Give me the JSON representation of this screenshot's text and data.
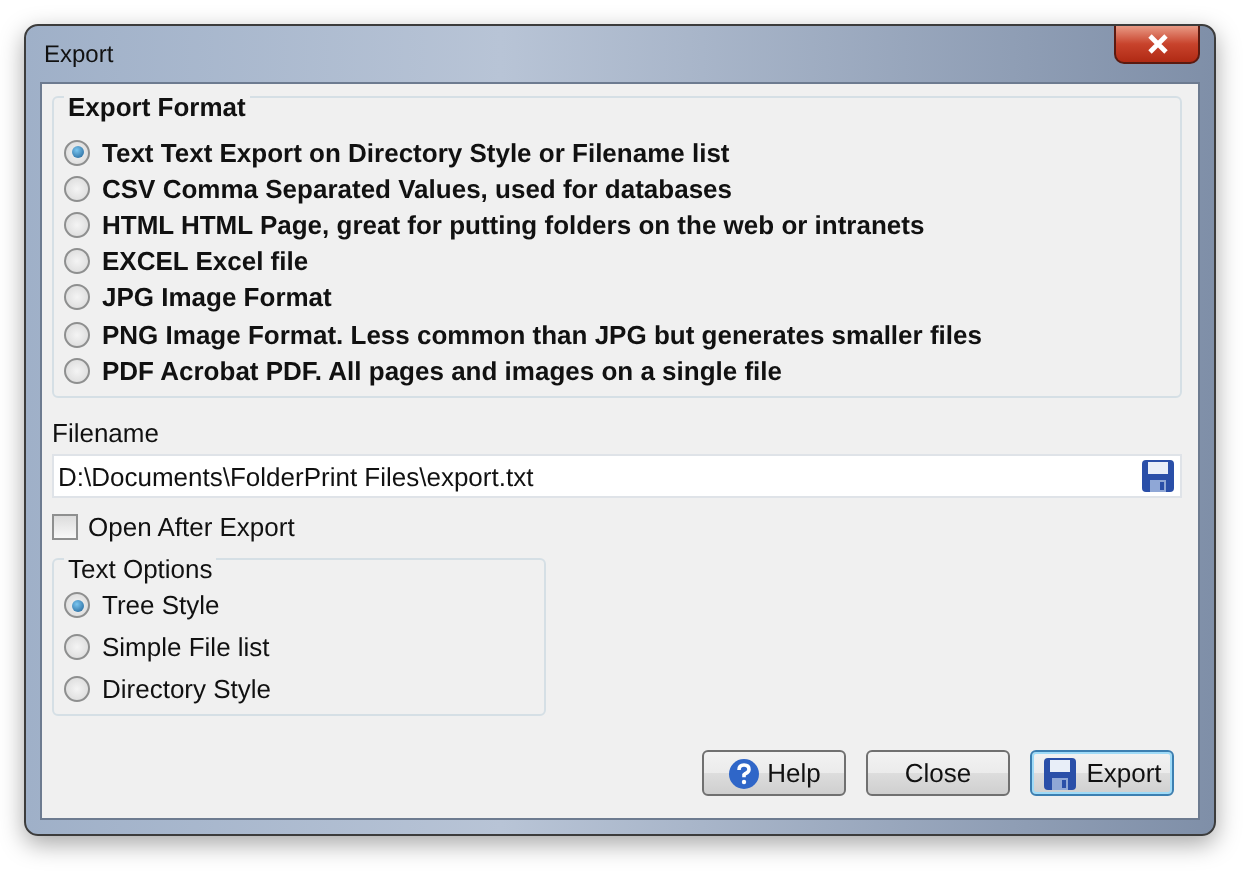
{
  "window": {
    "title": "Export"
  },
  "export_format": {
    "title": "Export Format",
    "options": [
      {
        "label": "Text Text Export on Directory Style or Filename list",
        "selected": true
      },
      {
        "label": "CSV Comma Separated Values, used for databases",
        "selected": false
      },
      {
        "label": "HTML HTML Page, great for putting folders on the web or intranets",
        "selected": false
      },
      {
        "label": "EXCEL Excel file",
        "selected": false
      },
      {
        "label": "JPG Image Format",
        "selected": false
      },
      {
        "label": "PNG Image Format. Less common than JPG but generates smaller files",
        "selected": false
      },
      {
        "label": "PDF Acrobat PDF. All pages and images on a single file",
        "selected": false
      }
    ]
  },
  "filename": {
    "label": "Filename",
    "value": "D:\\Documents\\FolderPrint Files\\export.txt"
  },
  "open_after_export": {
    "label": "Open After Export",
    "checked": false
  },
  "text_options": {
    "title": "Text Options",
    "options": [
      {
        "label": "Tree Style",
        "selected": true
      },
      {
        "label": "Simple File list",
        "selected": false
      },
      {
        "label": "Directory Style",
        "selected": false
      }
    ]
  },
  "buttons": [
    {
      "label": "Help",
      "kind": "help",
      "default": false
    },
    {
      "label": "Close",
      "kind": "plain",
      "default": false
    },
    {
      "label": "Export",
      "kind": "save",
      "default": true
    }
  ]
}
